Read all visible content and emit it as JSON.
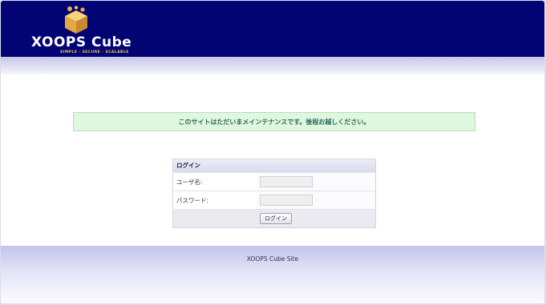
{
  "header": {
    "logo_text": "XOOPS Cube",
    "logo_tagline": "SIMPLE · SECURE · SCALABLE",
    "background_color": "#020474",
    "logo_icon": "cube-icon"
  },
  "notice": {
    "message": "このサイトはただいまメインテナンスです。後程お越しください。",
    "background_color": "#dff6df",
    "text_color": "#2f6c5e"
  },
  "login": {
    "title": "ログイン",
    "username_label": "ユーザ名:",
    "username_value": "",
    "password_label": "パスワード:",
    "password_value": "",
    "submit_label": "ログイン"
  },
  "footer": {
    "text": "XOOPS Cube Site"
  }
}
